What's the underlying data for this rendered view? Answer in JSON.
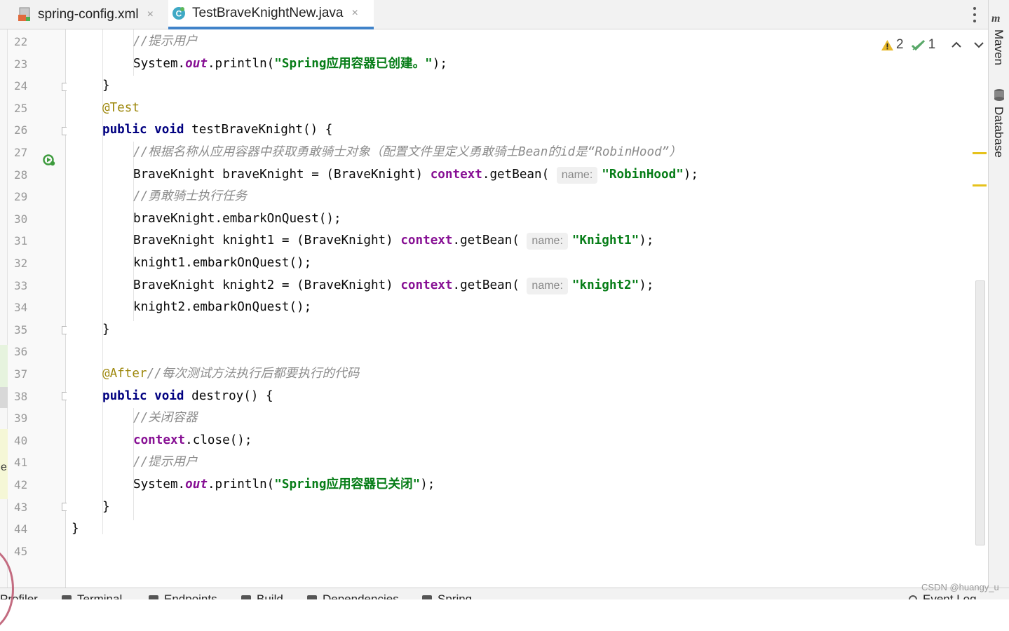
{
  "tabs": [
    {
      "label": "spring-config.xml",
      "icon": "xml-file-icon"
    },
    {
      "label": "TestBraveKnightNew.java",
      "icon": "java-class-icon",
      "active": true
    }
  ],
  "close_glyph": "×",
  "inspections": {
    "warnings": "2",
    "weak_warnings": "1"
  },
  "right_tools": {
    "maven": "Maven",
    "database": "Database"
  },
  "left_sliver_text": "e",
  "gutter": {
    "line_numbers": [
      "22",
      "23",
      "24",
      "25",
      "26",
      "27",
      "28",
      "29",
      "30",
      "31",
      "32",
      "33",
      "34",
      "35",
      "36",
      "37",
      "38",
      "39",
      "40",
      "41",
      "42",
      "43",
      "44",
      "45"
    ]
  },
  "code": {
    "l22": "//提示用户",
    "l23": [
      "System.",
      "out",
      ".println(",
      "\"Spring应用容器已创建。\"",
      ");"
    ],
    "l24": "}",
    "l25": "@Test",
    "l26": [
      "public",
      " ",
      "void",
      " testBraveKnight() {"
    ],
    "l27": "//根据名称从应用容器中获取勇敢骑士对象（配置文件里定义勇敢骑士Bean的id是“RobinHood”）",
    "l28": [
      "BraveKnight braveKnight = (BraveKnight) ",
      "context",
      ".getBean( ",
      "name:",
      "\"RobinHood\"",
      ");"
    ],
    "l29": "//勇敢骑士执行任务",
    "l30": "braveKnight.embarkOnQuest();",
    "l31": [
      "BraveKnight knight1 = (BraveKnight) ",
      "context",
      ".getBean( ",
      "name:",
      "\"Knight1\"",
      ");"
    ],
    "l32": "knight1.embarkOnQuest();",
    "l33": [
      "BraveKnight knight2 = (BraveKnight) ",
      "context",
      ".getBean( ",
      "name:",
      "\"knight2\"",
      ");"
    ],
    "l34": "knight2.embarkOnQuest();",
    "l35": "}",
    "l37": [
      "@After",
      "//每次测试方法执行后都要执行的代码"
    ],
    "l38": [
      "public",
      " ",
      "void",
      " destroy() {"
    ],
    "l39": "//关闭容器",
    "l40": [
      "context",
      ".close();"
    ],
    "l41": "//提示用户",
    "l42": [
      "System.",
      "out",
      ".println(",
      "\"Spring应用容器已关闭\"",
      ");"
    ],
    "l43": "}",
    "l44": "}"
  },
  "bottom_tools": [
    "Profiler",
    "Terminal",
    "Endpoints",
    "Build",
    "Dependencies",
    "Spring",
    "Event Log"
  ],
  "watermark": "CSDN @huangy_u",
  "colors": {
    "keyword": "#000080",
    "string": "#067d17",
    "comment": "#8c8c8c",
    "annotation": "#9e880d",
    "field": "#871094",
    "active_tab_underline": "#4083c9",
    "error_stripe_mark": "#e6c21c"
  }
}
